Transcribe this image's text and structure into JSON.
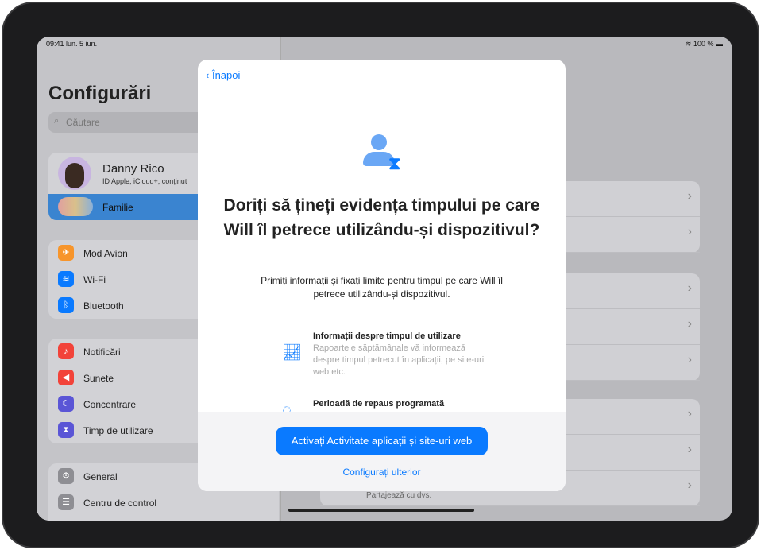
{
  "status": {
    "time": "09:41",
    "date": "lun. 5 iun.",
    "battery": "100 %"
  },
  "sidebar": {
    "title": "Configurări",
    "search_placeholder": "Căutare",
    "profile": {
      "name": "Danny Rico",
      "subtitle": "ID Apple, iCloud+, conținut"
    },
    "family": "Familie",
    "group1": [
      {
        "label": "Mod Avion",
        "icon": "airplane-icon",
        "color": "#f7952b"
      },
      {
        "label": "Wi-Fi",
        "icon": "wifi-icon",
        "color": "#0a7aff"
      },
      {
        "label": "Bluetooth",
        "icon": "bluetooth-icon",
        "color": "#0a7aff"
      }
    ],
    "group2": [
      {
        "label": "Notificări",
        "icon": "bell-icon",
        "color": "#f2433a"
      },
      {
        "label": "Sunete",
        "icon": "speaker-icon",
        "color": "#f2433a"
      },
      {
        "label": "Concentrare",
        "icon": "moon-icon",
        "color": "#5a55d6"
      },
      {
        "label": "Timp de utilizare",
        "icon": "hourglass-icon",
        "color": "#5a55d6"
      }
    ],
    "group3": [
      {
        "label": "General",
        "icon": "gear-icon",
        "color": "#8e8e93"
      },
      {
        "label": "Centru de control",
        "icon": "toggles-icon",
        "color": "#8e8e93"
      }
    ]
  },
  "detail": {
    "footer_text": "Partajează cu dvs."
  },
  "modal": {
    "back": "Înapoi",
    "heading": "Doriți să țineți evidența timpului pe care Will îl petrece utilizându-și dispozitivul?",
    "subtitle": "Primiți informații și fixați limite pentru timpul pe care Will îl petrece utilizându-și dispozitivul.",
    "features": [
      {
        "title": "Informații despre timpul de utilizare",
        "desc": "Rapoartele săptămânale vă informează despre timpul petrecut în aplicații, pe site-uri web etc."
      },
      {
        "title": "Perioadă de repaus programată",
        "desc": ""
      }
    ],
    "primary_button": "Activați Activitate aplicații și site-uri web",
    "secondary_button": "Configurați ulterior"
  }
}
